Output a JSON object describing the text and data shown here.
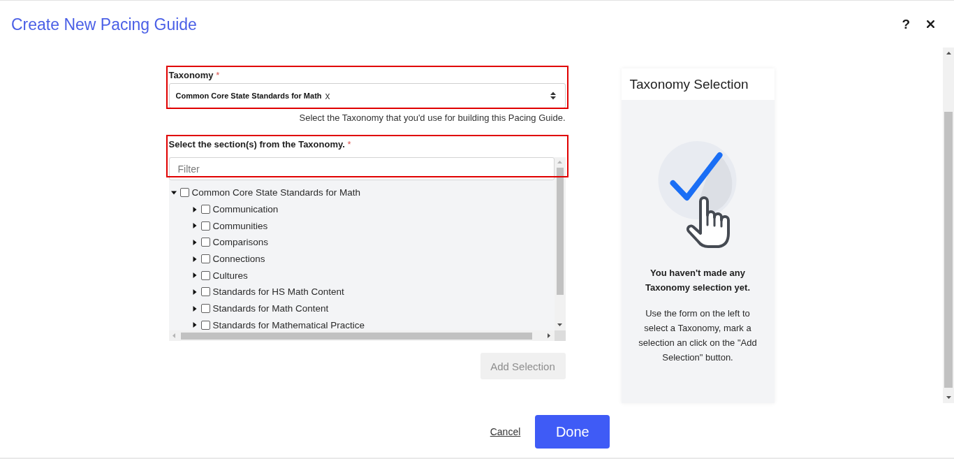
{
  "header": {
    "title": "Create New Pacing Guide",
    "help_label": "?"
  },
  "taxonomy": {
    "label": "Taxonomy",
    "required_mark": "*",
    "highlighted": true,
    "value": "Common Core State Standards for Math",
    "clear_label": "x",
    "hint": "Select the Taxonomy that you'd use for building this Pacing Guide."
  },
  "sections": {
    "label": "Select the section(s) from the Taxonomy.",
    "required_mark": "*",
    "highlighted": true,
    "filter": {
      "placeholder": "Filter"
    },
    "tree": [
      {
        "label": "Common Core State Standards for Math",
        "expanded": true,
        "checked": false,
        "children": [
          {
            "label": "Communication",
            "expanded": false,
            "checked": false
          },
          {
            "label": "Communities",
            "expanded": false,
            "checked": false
          },
          {
            "label": "Comparisons",
            "expanded": false,
            "checked": false
          },
          {
            "label": "Connections",
            "expanded": false,
            "checked": false
          },
          {
            "label": "Cultures",
            "expanded": false,
            "checked": false
          },
          {
            "label": "Standards for HS Math Content",
            "expanded": false,
            "checked": false
          },
          {
            "label": "Standards for Math Content",
            "expanded": false,
            "checked": false
          },
          {
            "label": "Standards for Mathematical Practice",
            "expanded": false,
            "checked": false
          }
        ]
      }
    ]
  },
  "add_button": {
    "label": "Add Selection",
    "disabled": true
  },
  "summary_panel": {
    "title": "Taxonomy Selection",
    "empty_title": "You haven't made any Taxonomy selection yet.",
    "empty_message": "Use the form on the left to select a Taxonomy, mark a selection an click on the \"Add Selection\" button."
  },
  "footer": {
    "cancel_label": "Cancel",
    "done_label": "Done"
  }
}
